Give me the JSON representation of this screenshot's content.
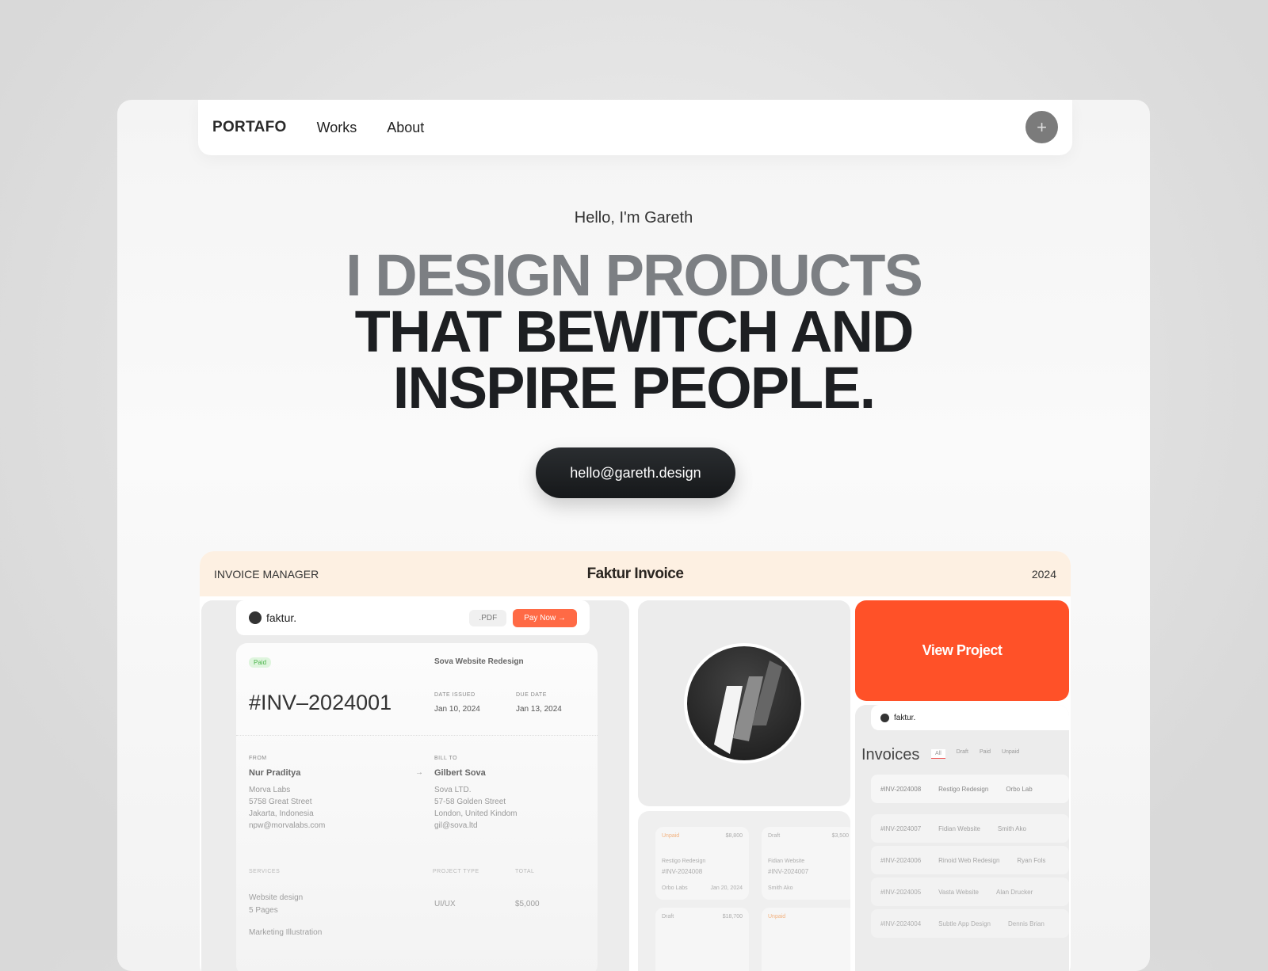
{
  "nav": {
    "logo": "PORTAFO",
    "links": [
      "Works",
      "About"
    ],
    "plus_icon": "plus-icon"
  },
  "hero": {
    "greeting": "Hello, I'm Gareth",
    "headline_line1": "I DESIGN PRODUCTS",
    "headline_line2": "THAT BEWITCH AND",
    "headline_line3": "INSPIRE PEOPLE.",
    "email": "hello@gareth.design"
  },
  "project": {
    "category": "INVOICE MANAGER",
    "title": "Faktur Invoice",
    "year": "2024",
    "view_label": "View Project",
    "accent": "#ff5128",
    "invoice": {
      "brand": "faktur.",
      "pdf": ".PDF",
      "pay": "Pay Now →",
      "status": "Paid",
      "project": "Sova Website Redesign",
      "number": "#INV–2024001",
      "date_issued_label": "DATE ISSUED",
      "date_issued": "Jan 10, 2024",
      "due_label": "DUE DATE",
      "due": "Jan 13, 2024",
      "from_label": "FROM",
      "from_name": "Nur Praditya",
      "from_lines": [
        "Morva Labs",
        "5758 Great Street",
        "Jakarta, Indonesia",
        "npw@morvalabs.com"
      ],
      "to_label": "BILL TO",
      "to_name": "Gilbert Sova",
      "to_lines": [
        "Sova LTD.",
        "57-58 Golden Street",
        "London, United Kindom",
        "gil@sova.ltd"
      ],
      "services_label": "SERVICES",
      "type_label": "PROJECT TYPE",
      "total_label": "TOTAL",
      "service1": "Website design",
      "service1_sub": "5 Pages",
      "service1_type": "UI/UX",
      "service1_total": "$5,000",
      "service2": "Marketing Illustration"
    },
    "list": {
      "brand": "faktur.",
      "title": "Invoices",
      "filters": [
        "All",
        "Draft",
        "Paid",
        "Unpaid"
      ],
      "rows": [
        [
          "#INV-2024008",
          "Restigo Redesign",
          "Orbo Lab"
        ],
        [
          "#INV-2024007",
          "Fidian Website",
          "Smith Ako"
        ],
        [
          "#INV-2024006",
          "Rinoid Web Redesign",
          "Ryan Fols"
        ],
        [
          "#INV-2024005",
          "Vasta Website",
          "Alan Drucker"
        ],
        [
          "#INV-2024004",
          "Subtle App Design",
          "Dennis Brian"
        ]
      ]
    },
    "cards": [
      {
        "status": "Unpaid",
        "amount": "$8,800",
        "name": "Restigo Redesign",
        "number": "#INV-2024008",
        "client": "Orbo Labs",
        "date": "Jan 20, 2024"
      },
      {
        "status": "Draft",
        "amount": "$3,500",
        "name": "Fidian Website",
        "number": "#INV-2024007",
        "client": "Smith Ako"
      },
      {
        "status": "Draft",
        "amount": "$18,700"
      },
      {
        "status": "Unpaid"
      }
    ]
  }
}
